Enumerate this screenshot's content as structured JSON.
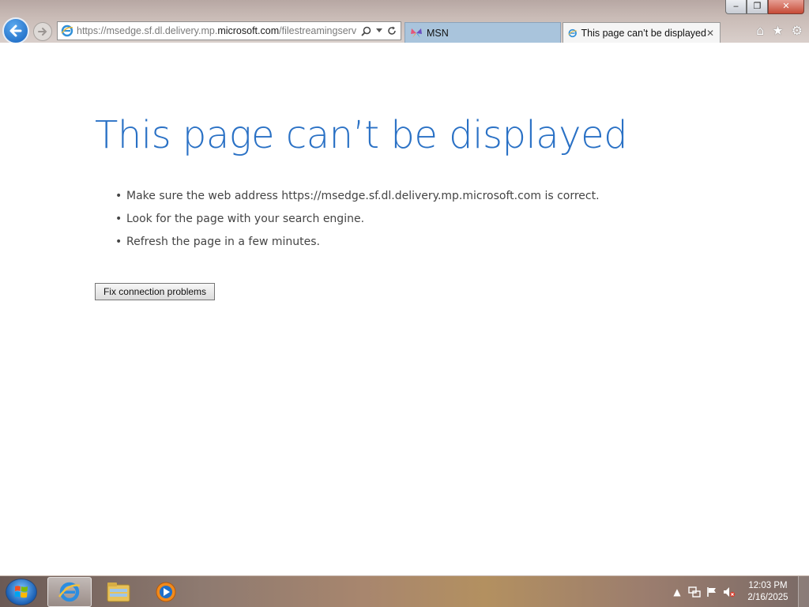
{
  "window": {
    "minimize_label": "‒",
    "maximize_label": "❐",
    "close_label": "✕"
  },
  "addressbar": {
    "url_prefix": "https://msedge.sf.dl.delivery.mp.",
    "url_domain": "microsoft.com",
    "url_suffix": "/filestreamingservic"
  },
  "tabs": [
    {
      "label": "MSN",
      "active": false
    },
    {
      "label": "This page can’t be displayed",
      "active": true,
      "close_label": "✕"
    }
  ],
  "error_page": {
    "title": "This page can’t be displayed",
    "tips": [
      "Make sure the web address https://msedge.sf.dl.delivery.mp.microsoft.com is correct.",
      "Look for the page with your search engine.",
      "Refresh the page in a few minutes."
    ],
    "fix_button_label": "Fix connection problems"
  },
  "taskbar": {
    "clock_time": "12:03 PM",
    "clock_date": "2/16/2025"
  },
  "colors": {
    "title_blue": "#2a71c5",
    "back_button_blue": "#1663bf",
    "msn_tab_bg": "#a9c4dc"
  },
  "icons": [
    "back-arrow-icon",
    "forward-arrow-icon",
    "ie-favicon",
    "search-icon",
    "dropdown-icon",
    "refresh-icon",
    "msn-butterfly-icon",
    "home-icon",
    "favorites-star-icon",
    "tools-gear-icon",
    "windows-start-icon",
    "file-explorer-icon",
    "media-player-icon",
    "tray-expand-icon",
    "network-icon",
    "action-center-flag-icon",
    "volume-muted-icon"
  ]
}
